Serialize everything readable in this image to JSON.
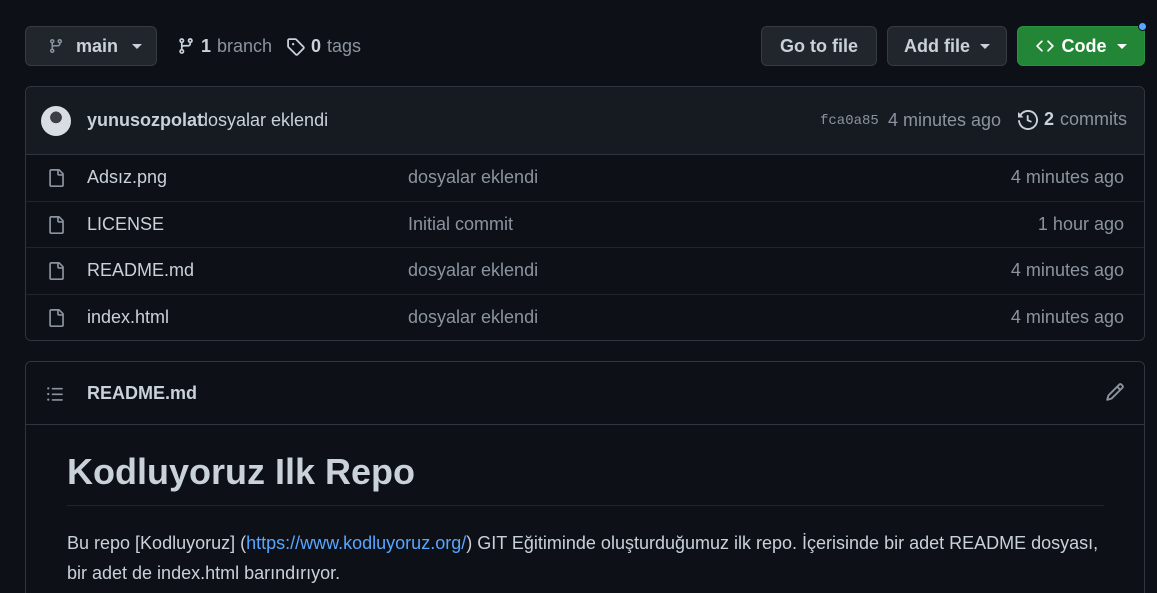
{
  "toolbar": {
    "branch_label": "main",
    "branch_count": "1",
    "branch_word": "branch",
    "tag_count": "0",
    "tag_word": "tags",
    "goto_label": "Go to file",
    "add_label": "Add file",
    "code_label": "Code"
  },
  "latest_commit": {
    "author": "yunusozpolat",
    "message": "dosyalar eklendi",
    "sha": "fca0a85",
    "time": "4 minutes ago",
    "commit_count": "2",
    "commit_word": "commits"
  },
  "files": [
    {
      "name": "Adsız.png",
      "message": "dosyalar eklendi",
      "time": "4 minutes ago"
    },
    {
      "name": "LICENSE",
      "message": "Initial commit",
      "time": "1 hour ago"
    },
    {
      "name": "README.md",
      "message": "dosyalar eklendi",
      "time": "4 minutes ago"
    },
    {
      "name": "index.html",
      "message": "dosyalar eklendi",
      "time": "4 minutes ago"
    }
  ],
  "readme": {
    "filename": "README.md",
    "heading": "Kodluyoruz Ilk Repo",
    "para_before": "Bu repo [Kodluyoruz] (",
    "link": "https://www.kodluyoruz.org/",
    "para_after": ") GIT Eğitiminde oluşturduğumuz ilk repo. İçerisinde bir adet README dosyası, bir adet de index.html barındırıyor."
  },
  "icons": {
    "branch": "git-branch-icon",
    "tag": "tag-icon",
    "code": "code-icon",
    "history": "history-icon",
    "file": "file-icon",
    "list": "list-icon",
    "edit": "pencil-icon"
  },
  "colors": {
    "background": "#0d1117",
    "code_button": "#238636",
    "link": "#58a6ff",
    "notification_dot": "#58a6ff"
  }
}
